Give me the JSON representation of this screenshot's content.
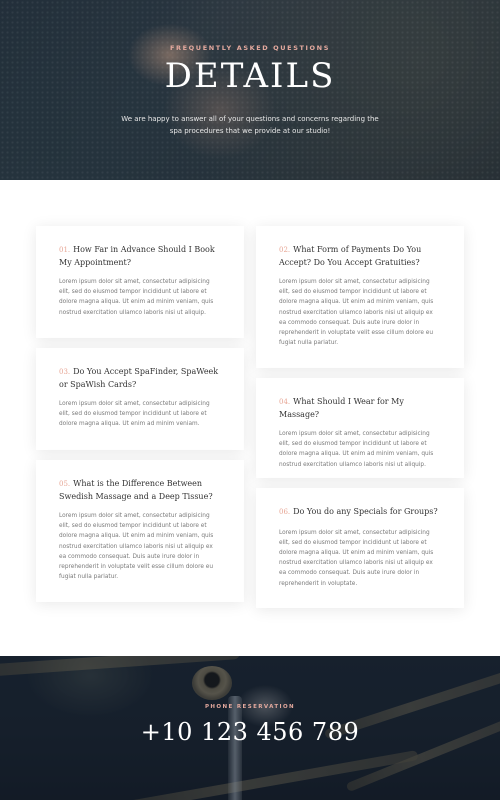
{
  "hero": {
    "eyebrow": "FREQUENTLY ASKED QUESTIONS",
    "title": "DETAILS",
    "description": "We are happy to answer all of your questions and concerns regarding the spa procedures that we provide at our studio!"
  },
  "faq": {
    "items": [
      {
        "num": "01.",
        "question": "How Far in Advance Should I Book My Appointment?",
        "answer": "Lorem ipsum dolor sit amet, consectetur adipisicing elit, sed do eiusmod tempor incididunt ut labore et dolore magna aliqua. Ut enim ad minim veniam, quis nostrud exercitation ullamco laboris nisi ut aliquip."
      },
      {
        "num": "02.",
        "question": "What Form of Payments Do You Accept? Do You Accept Gratuities?",
        "answer": "Lorem ipsum dolor sit amet, consectetur adipisicing elit, sed do eiusmod tempor incididunt ut labore et dolore magna aliqua. Ut enim ad minim veniam, quis nostrud exercitation ullamco laboris nisi ut aliquip ex ea commodo consequat. Duis aute irure dolor in reprehenderit in voluptate velit esse cillum dolore eu fugiat nulla pariatur."
      },
      {
        "num": "03.",
        "question": "Do You Accept SpaFinder, SpaWeek or SpaWish Cards?",
        "answer": "Lorem ipsum dolor sit amet, consectetur adipisicing elit, sed do eiusmod tempor incididunt ut labore et dolore magna aliqua. Ut enim ad minim veniam."
      },
      {
        "num": "04.",
        "question": "What Should I Wear for My Massage?",
        "answer": "Lorem ipsum dolor sit amet, consectetur adipisicing elit, sed do eiusmod tempor incididunt ut labore et dolore magna aliqua. Ut enim ad minim veniam, quis nostrud exercitation ullamco laboris nisi ut aliquip."
      },
      {
        "num": "05.",
        "question": "What is the Difference Between Swedish Massage and a Deep Tissue?",
        "answer": "Lorem ipsum dolor sit amet, consectetur adipisicing elit, sed do eiusmod tempor incididunt ut labore et dolore magna aliqua. Ut enim ad minim veniam, quis nostrud exercitation ullamco laboris nisi ut aliquip ex ea commodo consequat. Duis aute irure dolor in reprehenderit in voluptate velit esse cillum dolore eu fugiat nulla pariatur."
      },
      {
        "num": "06.",
        "question": "Do You do any Specials for Groups?",
        "answer": "Lorem ipsum dolor sit amet, consectetur adipisicing elit, sed do eiusmod tempor incididunt ut labore et dolore magna aliqua. Ut enim ad minim veniam, quis nostrud exercitation ullamco laboris nisi ut aliquip ex ea commodo consequat. Duis aute irure dolor in reprehenderit in voluptate."
      }
    ]
  },
  "footer": {
    "eyebrow": "PHONE RESERVATION",
    "phone": "+10 123 456 789"
  },
  "colors": {
    "accent": "#e4a99e",
    "number": "#e7a695",
    "hero_bg": "#2e3a44",
    "footer_bg": "#1a2431"
  }
}
